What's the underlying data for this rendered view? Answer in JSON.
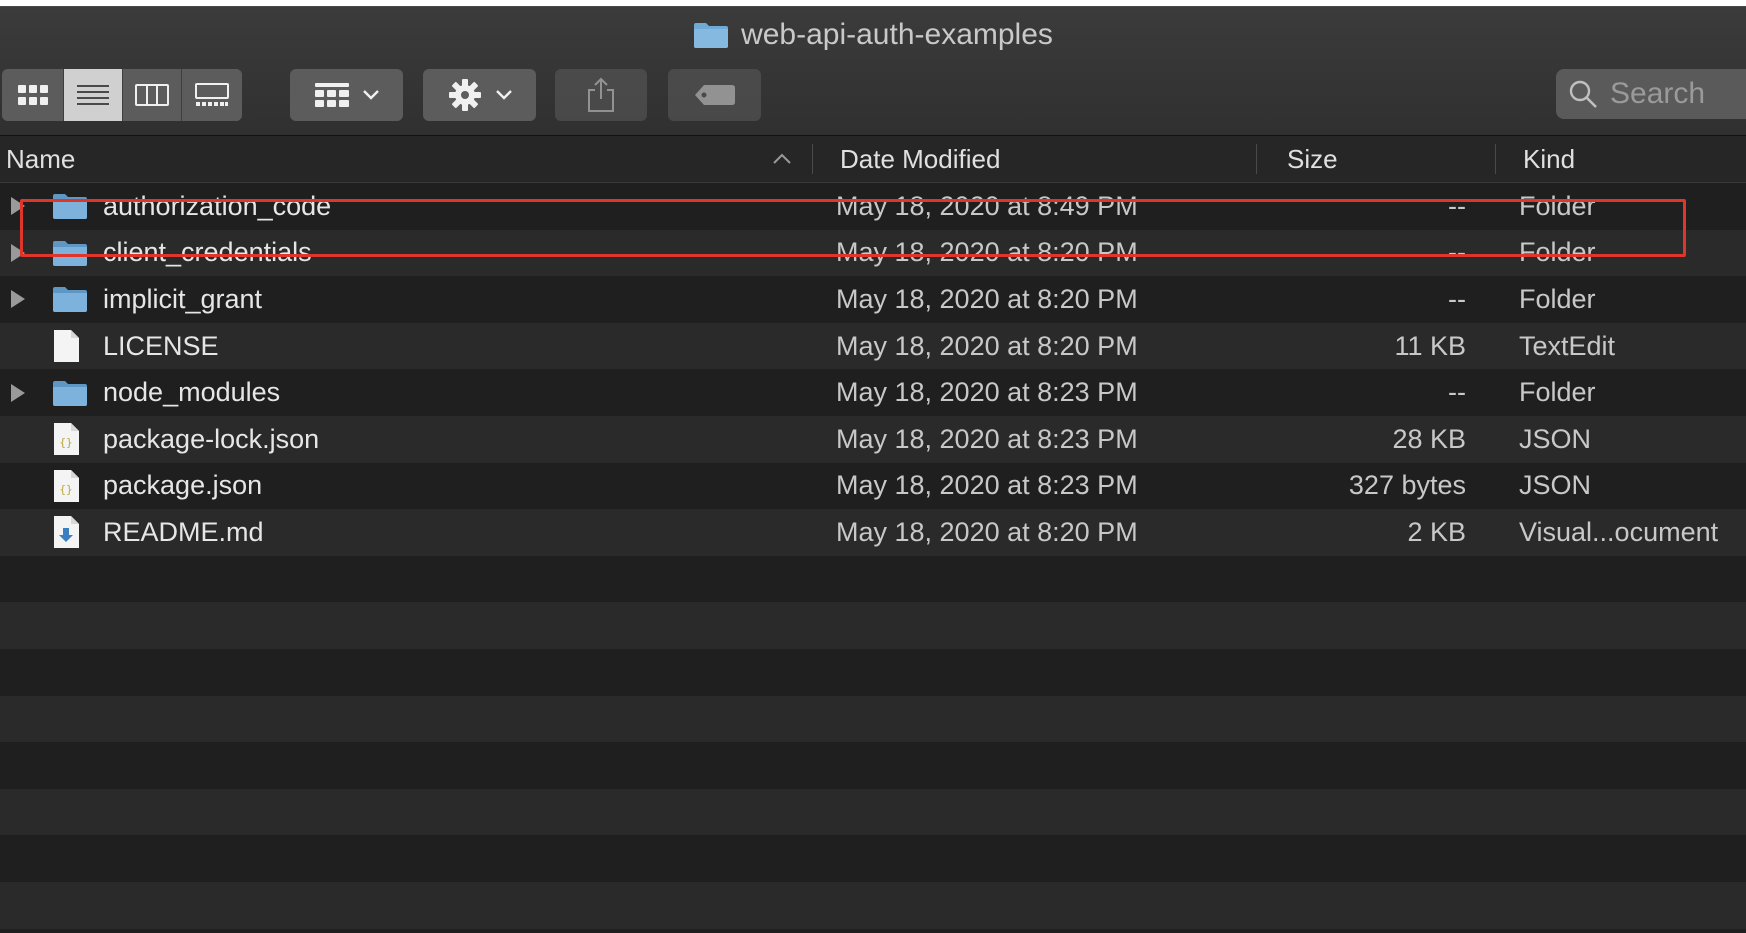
{
  "window": {
    "title": "web-api-auth-examples"
  },
  "toolbar": {
    "view_buttons": [
      {
        "icon": "icon-view-icon",
        "active": false
      },
      {
        "icon": "list-view-icon",
        "active": true
      },
      {
        "icon": "column-view-icon",
        "active": false
      },
      {
        "icon": "gallery-view-icon",
        "active": false
      }
    ],
    "group_button": {
      "icon": "group-by-icon"
    },
    "action_button": {
      "icon": "gear-icon"
    },
    "share_button": {
      "icon": "share-icon",
      "enabled": false
    },
    "tag_button": {
      "icon": "tag-icon",
      "enabled": false
    },
    "search": {
      "placeholder": "Search"
    }
  },
  "columns": {
    "name": "Name",
    "date": "Date Modified",
    "size": "Size",
    "kind": "Kind",
    "sort": "name-ascending"
  },
  "files": [
    {
      "name": "authorization_code",
      "date": "May 18, 2020 at 8:49 PM",
      "size": "--",
      "kind": "Folder",
      "type": "folder",
      "highlighted": true
    },
    {
      "name": "client_credentials",
      "date": "May 18, 2020 at 8:20 PM",
      "size": "--",
      "kind": "Folder",
      "type": "folder"
    },
    {
      "name": "implicit_grant",
      "date": "May 18, 2020 at 8:20 PM",
      "size": "--",
      "kind": "Folder",
      "type": "folder"
    },
    {
      "name": "LICENSE",
      "date": "May 18, 2020 at 8:20 PM",
      "size": "11 KB",
      "kind": "TextEdit",
      "type": "text"
    },
    {
      "name": "node_modules",
      "date": "May 18, 2020 at 8:23 PM",
      "size": "--",
      "kind": "Folder",
      "type": "folder"
    },
    {
      "name": "package-lock.json",
      "date": "May 18, 2020 at 8:23 PM",
      "size": "28 KB",
      "kind": "JSON",
      "type": "json"
    },
    {
      "name": "package.json",
      "date": "May 18, 2020 at 8:23 PM",
      "size": "327 bytes",
      "kind": "JSON",
      "type": "json"
    },
    {
      "name": "README.md",
      "date": "May 18, 2020 at 8:20 PM",
      "size": "2 KB",
      "kind": "Visual...ocument",
      "type": "markdown"
    }
  ],
  "colors": {
    "background": "#1f1f1f",
    "row_alt": "#2a2a2a",
    "folder": "#6fa9d6",
    "highlight_box": "#e0352b"
  }
}
